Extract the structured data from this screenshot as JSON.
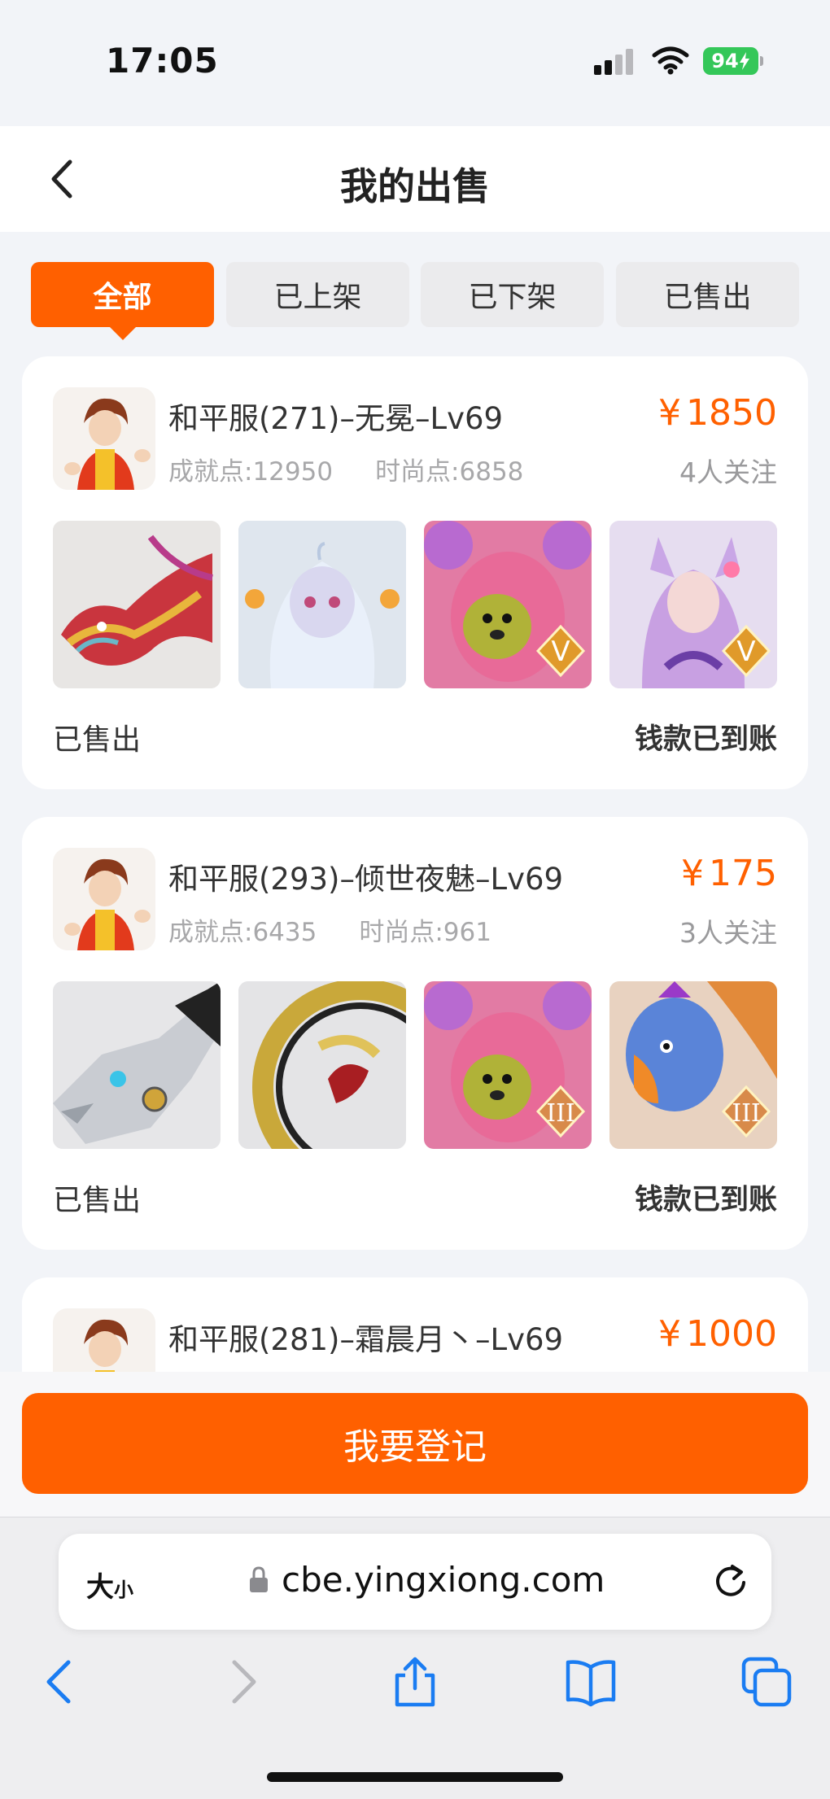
{
  "status_bar": {
    "time": "17:05",
    "battery": "94"
  },
  "header": {
    "title": "我的出售"
  },
  "tabs": [
    {
      "label": "全部",
      "active": true
    },
    {
      "label": "已上架",
      "active": false
    },
    {
      "label": "已下架",
      "active": false
    },
    {
      "label": "已售出",
      "active": false
    }
  ],
  "listings": [
    {
      "title": "和平服(271)–无冕–Lv69",
      "achievement": "成就点:12950",
      "fashion": "时尚点:6858",
      "currency": "¥",
      "price": "1850",
      "followers": "4人关注",
      "status": "已售出",
      "payment": "钱款已到账",
      "items": [
        {
          "icon": "dragon-icon",
          "badge": ""
        },
        {
          "icon": "spirit-girl-icon",
          "badge": ""
        },
        {
          "icon": "pink-bear-icon",
          "badge": "V"
        },
        {
          "icon": "fox-fairy-icon",
          "badge": "V"
        }
      ]
    },
    {
      "title": "和平服(293)–倾世夜魅–Lv69",
      "achievement": "成就点:6435",
      "fashion": "时尚点:961",
      "currency": "¥",
      "price": "175",
      "followers": "3人关注",
      "status": "已售出",
      "payment": "钱款已到账",
      "items": [
        {
          "icon": "mech-dragon-icon",
          "badge": ""
        },
        {
          "icon": "golden-ring-icon",
          "badge": ""
        },
        {
          "icon": "pink-bear-icon",
          "badge": "III"
        },
        {
          "icon": "eagle-icon",
          "badge": "III"
        }
      ]
    },
    {
      "title": "和平服(281)–霜晨月丶–Lv69",
      "achievement": "",
      "fashion": "",
      "currency": "¥",
      "price": "1000",
      "followers": "",
      "status": "",
      "payment": "",
      "items": []
    }
  ],
  "actions": {
    "register_label": "我要登记"
  },
  "browser": {
    "text_size_big": "大",
    "text_size_small": "小",
    "url": "cbe.yingxiong.com"
  },
  "colors": {
    "accent": "#ff6000",
    "background": "#f2f4f8"
  }
}
